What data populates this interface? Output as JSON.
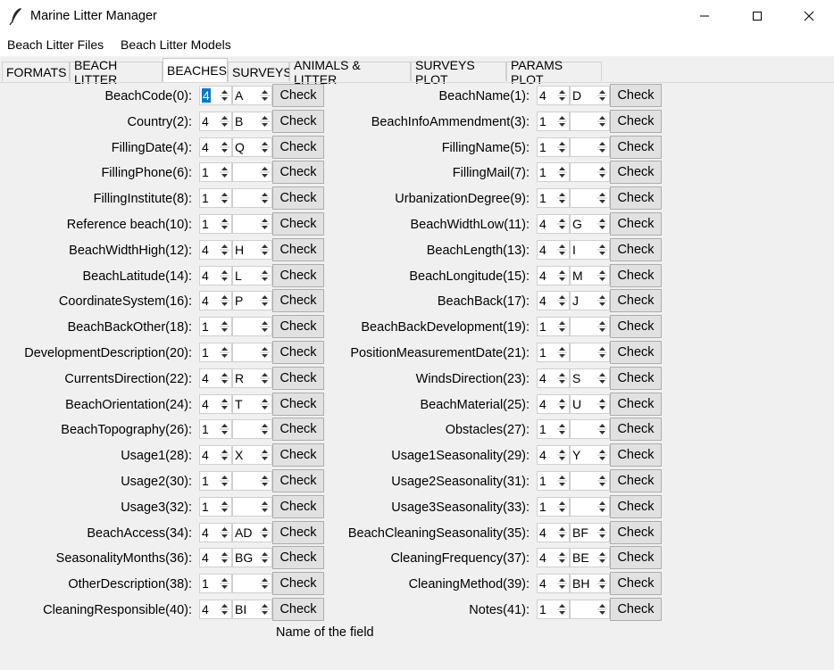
{
  "window": {
    "title": "Marine Litter Manager"
  },
  "menu": [
    "Beach Litter Files",
    "Beach Litter Models"
  ],
  "tabs": [
    "FORMATS",
    "BEACH LITTER",
    "BEACHES",
    "SURVEYS",
    "ANIMALS & LITTER",
    "SURVEYS PLOT",
    "PARAMS PLOT"
  ],
  "selected_tab": "BEACHES",
  "check_label": "Check",
  "status_text": "Name of the field",
  "rows": [
    {
      "left": {
        "label": "BeachCode(0):",
        "num": "4",
        "col": "A"
      },
      "right": {
        "label": "BeachName(1):",
        "num": "4",
        "col": "D"
      }
    },
    {
      "left": {
        "label": "Country(2):",
        "num": "4",
        "col": "B"
      },
      "right": {
        "label": "BeachInfoAmmendment(3):",
        "num": "1",
        "col": ""
      }
    },
    {
      "left": {
        "label": "FillingDate(4):",
        "num": "4",
        "col": "Q"
      },
      "right": {
        "label": "FillingName(5):",
        "num": "1",
        "col": ""
      }
    },
    {
      "left": {
        "label": "FillingPhone(6):",
        "num": "1",
        "col": ""
      },
      "right": {
        "label": "FillingMail(7):",
        "num": "1",
        "col": ""
      }
    },
    {
      "left": {
        "label": "FillingInstitute(8):",
        "num": "1",
        "col": ""
      },
      "right": {
        "label": "UrbanizationDegree(9):",
        "num": "1",
        "col": ""
      }
    },
    {
      "left": {
        "label": "Reference beach(10):",
        "num": "1",
        "col": ""
      },
      "right": {
        "label": "BeachWidthLow(11):",
        "num": "4",
        "col": "G"
      }
    },
    {
      "left": {
        "label": "BeachWidthHigh(12):",
        "num": "4",
        "col": "H"
      },
      "right": {
        "label": "BeachLength(13):",
        "num": "4",
        "col": "I"
      }
    },
    {
      "left": {
        "label": "BeachLatitude(14):",
        "num": "4",
        "col": "L"
      },
      "right": {
        "label": "BeachLongitude(15):",
        "num": "4",
        "col": "M"
      }
    },
    {
      "left": {
        "label": "CoordinateSystem(16):",
        "num": "4",
        "col": "P"
      },
      "right": {
        "label": "BeachBack(17):",
        "num": "4",
        "col": "J"
      }
    },
    {
      "left": {
        "label": "BeachBackOther(18):",
        "num": "1",
        "col": ""
      },
      "right": {
        "label": "BeachBackDevelopment(19):",
        "num": "1",
        "col": ""
      }
    },
    {
      "left": {
        "label": "DevelopmentDescription(20):",
        "num": "1",
        "col": ""
      },
      "right": {
        "label": "PositionMeasurementDate(21):",
        "num": "1",
        "col": ""
      }
    },
    {
      "left": {
        "label": "CurrentsDirection(22):",
        "num": "4",
        "col": "R"
      },
      "right": {
        "label": "WindsDirection(23):",
        "num": "4",
        "col": "S"
      }
    },
    {
      "left": {
        "label": "BeachOrientation(24):",
        "num": "4",
        "col": "T"
      },
      "right": {
        "label": "BeachMaterial(25):",
        "num": "4",
        "col": "U"
      }
    },
    {
      "left": {
        "label": "BeachTopography(26):",
        "num": "1",
        "col": ""
      },
      "right": {
        "label": "Obstacles(27):",
        "num": "1",
        "col": ""
      }
    },
    {
      "left": {
        "label": "Usage1(28):",
        "num": "4",
        "col": "X"
      },
      "right": {
        "label": "Usage1Seasonality(29):",
        "num": "4",
        "col": "Y"
      }
    },
    {
      "left": {
        "label": "Usage2(30):",
        "num": "1",
        "col": ""
      },
      "right": {
        "label": "Usage2Seasonality(31):",
        "num": "1",
        "col": ""
      }
    },
    {
      "left": {
        "label": "Usage3(32):",
        "num": "1",
        "col": ""
      },
      "right": {
        "label": "Usage3Seasonality(33):",
        "num": "1",
        "col": ""
      }
    },
    {
      "left": {
        "label": "BeachAccess(34):",
        "num": "4",
        "col": "AD"
      },
      "right": {
        "label": "BeachCleaningSeasonality(35):",
        "num": "4",
        "col": "BF"
      }
    },
    {
      "left": {
        "label": "SeasonalityMonths(36):",
        "num": "4",
        "col": "BG"
      },
      "right": {
        "label": "CleaningFrequency(37):",
        "num": "4",
        "col": "BE"
      }
    },
    {
      "left": {
        "label": "OtherDescription(38):",
        "num": "1",
        "col": ""
      },
      "right": {
        "label": "CleaningMethod(39):",
        "num": "4",
        "col": "BH"
      }
    },
    {
      "left": {
        "label": "CleaningResponsible(40):",
        "num": "4",
        "col": "BI"
      },
      "right": {
        "label": "Notes(41):",
        "num": "1",
        "col": ""
      }
    }
  ]
}
